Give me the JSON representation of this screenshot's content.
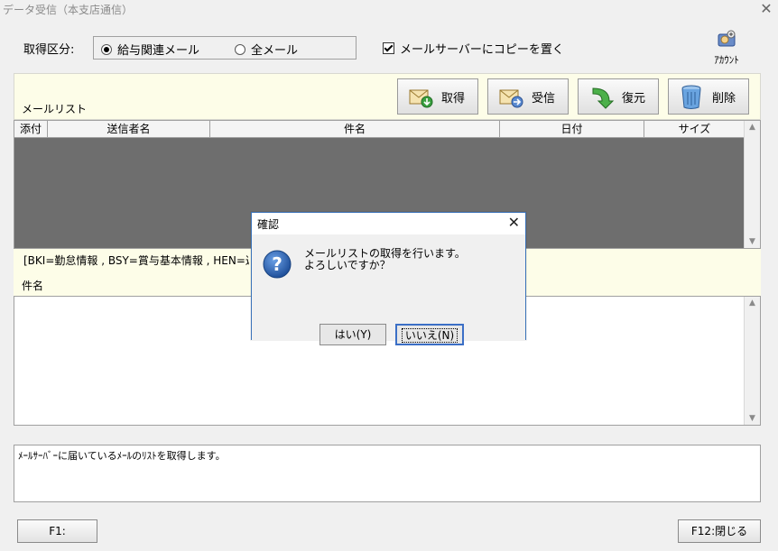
{
  "window": {
    "title": "データ受信（本支店通信）"
  },
  "acquisition": {
    "label": "取得区分:",
    "options": [
      {
        "label": "給与関連メール",
        "selected": true
      },
      {
        "label": "全メール",
        "selected": false
      }
    ]
  },
  "copy_option": {
    "label": "メールサーバーにコピーを置く",
    "checked": true
  },
  "account_button": {
    "label": "ｱｶｳﾝﾄ",
    "icon": "account-icon"
  },
  "mail_list": {
    "label": "メールリスト"
  },
  "toolbar": {
    "get": "取得",
    "receive": "受信",
    "restore": "復元",
    "delete": "削除"
  },
  "grid": {
    "columns": [
      "添付",
      "送信者名",
      "件名",
      "日付",
      "サイズ"
    ]
  },
  "legend_text": "[BKI=勤怠情報 , BSY=賞与基本情報 , HEN=返",
  "subject_label": "件名",
  "status_text": "ﾒｰﾙｻｰﾊﾞｰに届いているﾒｰﾙのﾘｽﾄを取得します。",
  "footer": {
    "f1": "F1:",
    "f12": "F12:閉じる"
  },
  "dialog": {
    "title": "確認",
    "line1": "メールリストの取得を行います。",
    "line2": "よろしいですか？",
    "yes": "はい(Y)",
    "no": "いいえ(N)"
  },
  "colors": {
    "grid_bg": "#6e6e6e",
    "panel_bg": "#fdfde8",
    "dialog_border": "#3b73b9",
    "question_blue": "#1f5fb0"
  }
}
